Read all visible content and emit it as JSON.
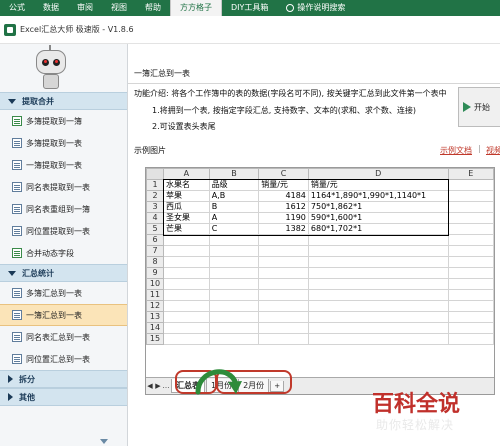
{
  "ribbon": {
    "tabs": [
      "公式",
      "数据",
      "审阅",
      "视图",
      "帮助",
      "方方格子",
      "DIY工具箱",
      "操作说明搜索"
    ],
    "active_index": 5
  },
  "window": {
    "title": "Excel汇总大师 极速版 - V1.8.6"
  },
  "sidebar": {
    "sections": [
      {
        "label": "提取合并",
        "expanded": true,
        "items": [
          "多簿提取到一簿",
          "多簿提取到一表",
          "一簿提取到一表",
          "同名表提取到一表",
          "同名表重组到一簿",
          "同位置提取到一表",
          "合并动态字段"
        ]
      },
      {
        "label": "汇总统计",
        "expanded": true,
        "items": [
          "多簿汇总到一表",
          "一簿汇总到一表",
          "同名表汇总到一表",
          "同位置汇总到一表"
        ],
        "selected_index": 1
      },
      {
        "label": "拆分",
        "expanded": false,
        "items": []
      },
      {
        "label": "其他",
        "expanded": false,
        "items": []
      }
    ]
  },
  "main": {
    "title": "一簿汇总到一表",
    "description": "功能介绍: 将各个工作簿中的表的数据(字段名可不同), 按关键字汇总到此文件第一个表中",
    "points": [
      "1.将拥到一个表, 按指定字段汇总, 支持数字、文本的(求和、求个数、连接)",
      "2.可设置表头表尾"
    ],
    "start_label": "开始",
    "example_label": "示例图片",
    "link_doc": "示例文档",
    "link_video": "视频教程",
    "link_sep": "|"
  },
  "sheet": {
    "columns": [
      "A",
      "B",
      "C",
      "D",
      "E"
    ],
    "rows": [
      [
        "水果名",
        "品级",
        "销量/元",
        "销量/元",
        ""
      ],
      [
        "苹果",
        "A,B",
        "4184",
        "1164*1,890*1,990*1,1140*1",
        ""
      ],
      [
        "西瓜",
        "B",
        "1612",
        "750*1,862*1",
        ""
      ],
      [
        "圣女果",
        "A",
        "1190",
        "590*1,600*1",
        ""
      ],
      [
        "芒果",
        "C",
        "1382",
        "680*1,702*1",
        ""
      ],
      [
        "",
        "",
        "",
        "",
        ""
      ],
      [
        "",
        "",
        "",
        "",
        ""
      ],
      [
        "",
        "",
        "",
        "",
        ""
      ],
      [
        "",
        "",
        "",
        "",
        ""
      ],
      [
        "",
        "",
        "",
        "",
        ""
      ],
      [
        "",
        "",
        "",
        "",
        ""
      ],
      [
        "",
        "",
        "",
        "",
        ""
      ],
      [
        "",
        "",
        "",
        "",
        ""
      ],
      [
        "",
        "",
        "",
        "",
        ""
      ],
      [
        "",
        "",
        "",
        "",
        ""
      ]
    ],
    "row_numbers": [
      "1",
      "2",
      "3",
      "4",
      "5",
      "6",
      "7",
      "8",
      "9",
      "10",
      "11",
      "12",
      "13",
      "14",
      "15"
    ],
    "tabs": [
      "汇总表",
      "1月份",
      "2月份"
    ],
    "active_tab": 0,
    "add_tab": "+"
  },
  "watermark": {
    "big": "百科全说",
    "small": "助你轻松解决"
  },
  "colors": {
    "excel_green": "#217346",
    "section_bg": "#d3e4ef",
    "selected_bg": "#fbe4b8",
    "annotation_red": "#c0392b",
    "arrow_green": "#2e8b3a"
  }
}
